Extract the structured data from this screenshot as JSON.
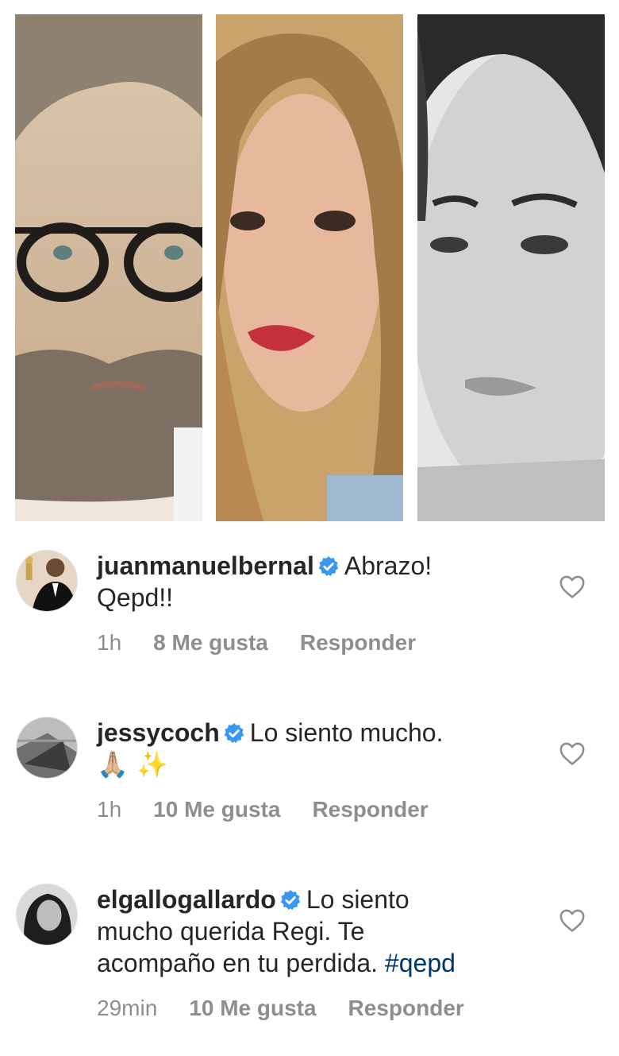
{
  "comments": [
    {
      "username": "juanmanuelbernal",
      "text_line1": "Abrazo!",
      "text_line2": "Qepd!!",
      "time": "1h",
      "likes": "8 Me gusta",
      "reply": "Responder"
    },
    {
      "username": "jessycoch",
      "text_line1": "Lo siento mucho.",
      "text_line2": "🙏🏼 ✨",
      "time": "1h",
      "likes": "10 Me gusta",
      "reply": "Responder"
    },
    {
      "username": "elgallogallardo",
      "text_line1": "Lo siento",
      "text_line2": "mucho querida Regi. Te",
      "text_line3": "acompaño en tu perdida.",
      "hashtag": "#qepd",
      "time": "29min",
      "likes": "10 Me gusta",
      "reply": "Responder"
    }
  ],
  "colors": {
    "verified_badge": "#3897f0",
    "hashtag": "#00376b",
    "meta_text": "#8e8e8e",
    "heart_outline": "#8e8e8e"
  },
  "icons": [
    "verified-badge-icon",
    "heart-icon"
  ]
}
